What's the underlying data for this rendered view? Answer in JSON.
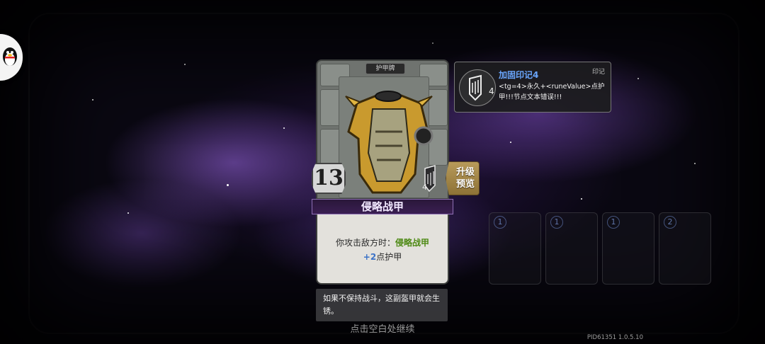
{
  "card": {
    "type_label": "护甲牌",
    "cost": "13",
    "name": "侵略战甲",
    "description": {
      "prefix": "你攻击敌方时：",
      "highlight_name": "侵略战甲",
      "amount": "+2",
      "suffix": "点护甲"
    },
    "rune_count": "4"
  },
  "upgrade_button": {
    "label": "升级\n预览"
  },
  "tooltip": {
    "title": "加固印记4",
    "tag": "印记",
    "body": "<tg=4>永久+<runeValue>点护甲!!!节点文本错误!!!",
    "count": "4"
  },
  "flavor_text": "如果不保持战斗，这副盔甲就会生锈。",
  "continue_hint": "点击空白处继续",
  "version": "PID61351  1.0.5.10",
  "ghost_cards": [
    {
      "badge": "1"
    },
    {
      "badge": "1"
    },
    {
      "badge": "1"
    },
    {
      "badge": "2"
    }
  ],
  "colors": {
    "card_name_highlight": "#4f8a16",
    "number_highlight": "#3b72c7",
    "tooltip_title": "#6aa7ff",
    "name_bar": "#3a1f52"
  }
}
